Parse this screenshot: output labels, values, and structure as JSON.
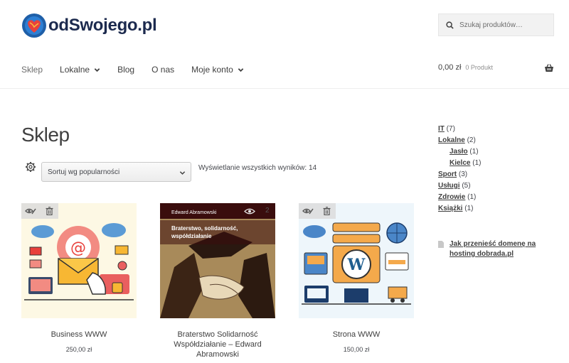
{
  "header": {
    "logo_text": "odSwojego.pl",
    "search_placeholder": "Szukaj produktów…"
  },
  "nav": {
    "items": [
      {
        "label": "Sklep",
        "dropdown": false
      },
      {
        "label": "Lokalne",
        "dropdown": true
      },
      {
        "label": "Blog",
        "dropdown": false
      },
      {
        "label": "O nas",
        "dropdown": false
      },
      {
        "label": "Moje konto",
        "dropdown": true
      }
    ]
  },
  "cart": {
    "total": "0,00 zł",
    "count_label": "0 Produkt"
  },
  "main": {
    "title": "Sklep",
    "sort_selected": "Sortuj wg popularności",
    "result_count": "Wyświetlanie wszystkich wyników: 14"
  },
  "products": [
    {
      "name": "Business WWW",
      "price": "250,00 zł"
    },
    {
      "name": "Braterstwo Solidarność Współdziałanie – Edward Abramowski",
      "price": "",
      "book_author": "Edward Abramowski",
      "book_title": "Braterstwo, solidarność, współdziałanie",
      "badge": "2"
    },
    {
      "name": "Strona WWW",
      "price": "150,00 zł"
    }
  ],
  "sidebar": {
    "categories": [
      {
        "label": "IT",
        "count": "(7)",
        "sub": false
      },
      {
        "label": "Lokalne",
        "count": "(2)",
        "sub": false
      },
      {
        "label": "Jasło",
        "count": "(1)",
        "sub": true
      },
      {
        "label": "Kielce",
        "count": "(1)",
        "sub": true
      },
      {
        "label": "Sport",
        "count": "(3)",
        "sub": false
      },
      {
        "label": "Usługi",
        "count": "(5)",
        "sub": false
      },
      {
        "label": "Zdrowie",
        "count": "(1)",
        "sub": false
      },
      {
        "label": "Książki",
        "count": "(1)",
        "sub": false
      }
    ],
    "post_title": "Jak przenieść domenę na hosting dobrada.pl"
  },
  "colors": {
    "accent": "#404040",
    "header_bg": "#ffffff",
    "search_bg": "#f2f2f2"
  }
}
